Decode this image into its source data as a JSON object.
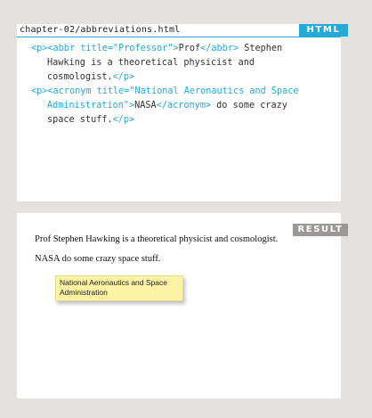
{
  "code_panel": {
    "filename": "chapter-02/abbreviations.html",
    "badge": "HTML",
    "lines": [
      [
        {
          "t": "<p>",
          "tag": true
        },
        {
          "t": "<abbr title=\"Professor\">",
          "tag": true
        },
        {
          "t": "Prof",
          "tag": false
        },
        {
          "t": "</abbr>",
          "tag": true
        },
        {
          "t": " Stephen",
          "tag": false
        }
      ],
      [
        {
          "t": "Hawking is a theoretical physicist and",
          "tag": false
        }
      ],
      [
        {
          "t": "cosmologist.",
          "tag": false
        },
        {
          "t": "</p>",
          "tag": true
        }
      ],
      [
        {
          "t": "<p>",
          "tag": true
        },
        {
          "t": "<acronym title=\"National Aeronautics and Space",
          "tag": true
        }
      ],
      [
        {
          "t": "Administration\">",
          "tag": true
        },
        {
          "t": "NASA",
          "tag": false
        },
        {
          "t": "</acronym>",
          "tag": true
        },
        {
          "t": " do some crazy",
          "tag": false
        }
      ],
      [
        {
          "t": "space stuff.",
          "tag": false
        },
        {
          "t": "</p>",
          "tag": true
        }
      ]
    ]
  },
  "result_panel": {
    "badge": "RESULT",
    "paragraph_1": "Prof Stephen Hawking is a theoretical physicist and cosmologist.",
    "paragraph_2": "NASA do some crazy space stuff.",
    "tooltip": "National Aeronautics and Space Administration"
  }
}
